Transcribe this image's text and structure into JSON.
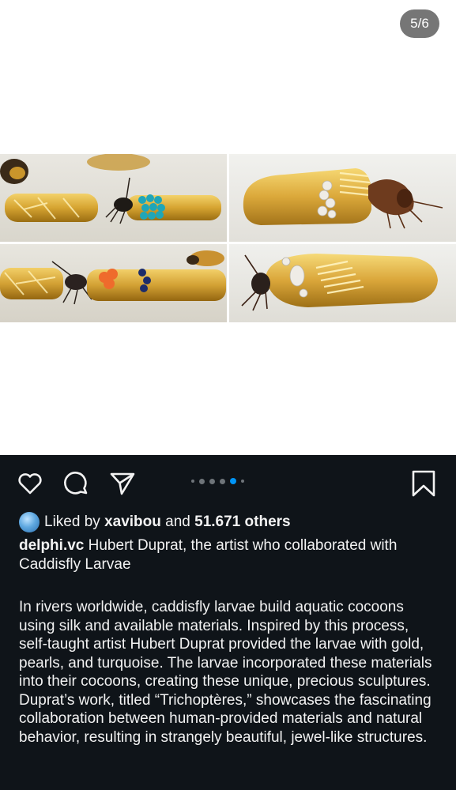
{
  "media": {
    "page_counter": "5/6",
    "carousel": {
      "total": 6,
      "current": 5
    },
    "photo_alts": [
      "Caddisfly larvae with gold and turquoise cocoons",
      "Caddisfly larva with gold and pearl cocoon",
      "Caddisfly larvae with gold, coral and sapphire cocoon",
      "Caddisfly larva with gold tube and pearl cocoon"
    ]
  },
  "actions": {
    "like_icon": "heart-icon",
    "comment_icon": "comment-bubble-icon",
    "share_icon": "paper-plane-icon",
    "save_icon": "bookmark-icon"
  },
  "likes": {
    "prefix": "Liked by",
    "liker": "xavibou",
    "conjunction": "and",
    "others": "51.671 others"
  },
  "caption": {
    "username": "delphi.vc",
    "headline": "Hubert Duprat, the artist who collaborated with Caddisfly Larvae",
    "body": "In rivers worldwide, caddisfly larvae build aquatic cocoons using silk and available materials. Inspired by this process, self-taught artist Hubert Duprat provided the larvae with gold, pearls, and turquoise. The larvae incorporated these materials into their cocoons, creating these unique, precious sculptures. Duprat’s work, titled “Trichoptères,” showcases the fascinating collaboration between human-provided materials and natural behavior, resulting in strangely beautiful, jewel-like structures."
  },
  "colors": {
    "panel_bg": "#0f1419",
    "text": "#f2f2f2",
    "active_dot": "#0095f6",
    "counter_bg": "#767676"
  }
}
